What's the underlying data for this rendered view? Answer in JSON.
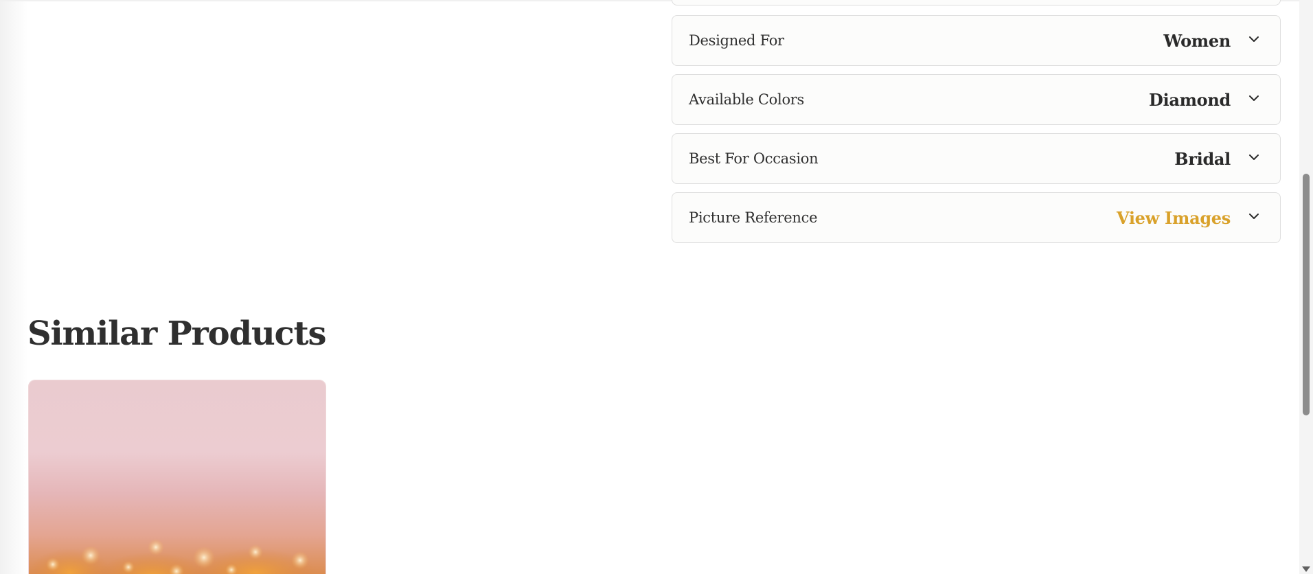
{
  "specs": [
    {
      "label": "Designed For",
      "value": "Women",
      "accent": false
    },
    {
      "label": "Available Colors",
      "value": "Diamond",
      "accent": false
    },
    {
      "label": "Best For Occasion",
      "value": "Bridal",
      "accent": false
    },
    {
      "label": "Picture Reference",
      "value": "View Images",
      "accent": true
    }
  ],
  "similar": {
    "title": "Similar Products"
  },
  "colors": {
    "text": "#2f2f2f",
    "accent": "#d9a12a",
    "row_bg": "#fcfcfb",
    "row_border": "#dedede"
  },
  "icons": {
    "row_expand": "chevron-down-icon"
  }
}
